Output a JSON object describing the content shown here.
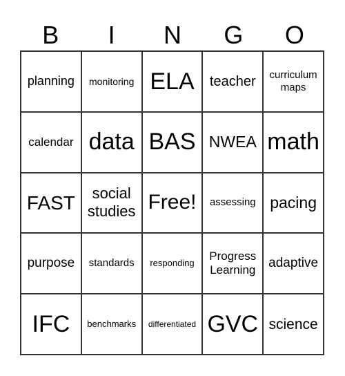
{
  "header": [
    "B",
    "I",
    "N",
    "G",
    "O"
  ],
  "cells": [
    "planning",
    "monitoring",
    "ELA",
    "teacher",
    "curriculum maps",
    "calendar",
    "data",
    "BAS",
    "NWEA",
    "math",
    "FAST",
    "social studies",
    "Free!",
    "assessing",
    "pacing",
    "purpose",
    "standards",
    "responding",
    "Progress Learning",
    "adaptive",
    "IFC",
    "benchmarks",
    "differentiated",
    "GVC",
    "science"
  ]
}
